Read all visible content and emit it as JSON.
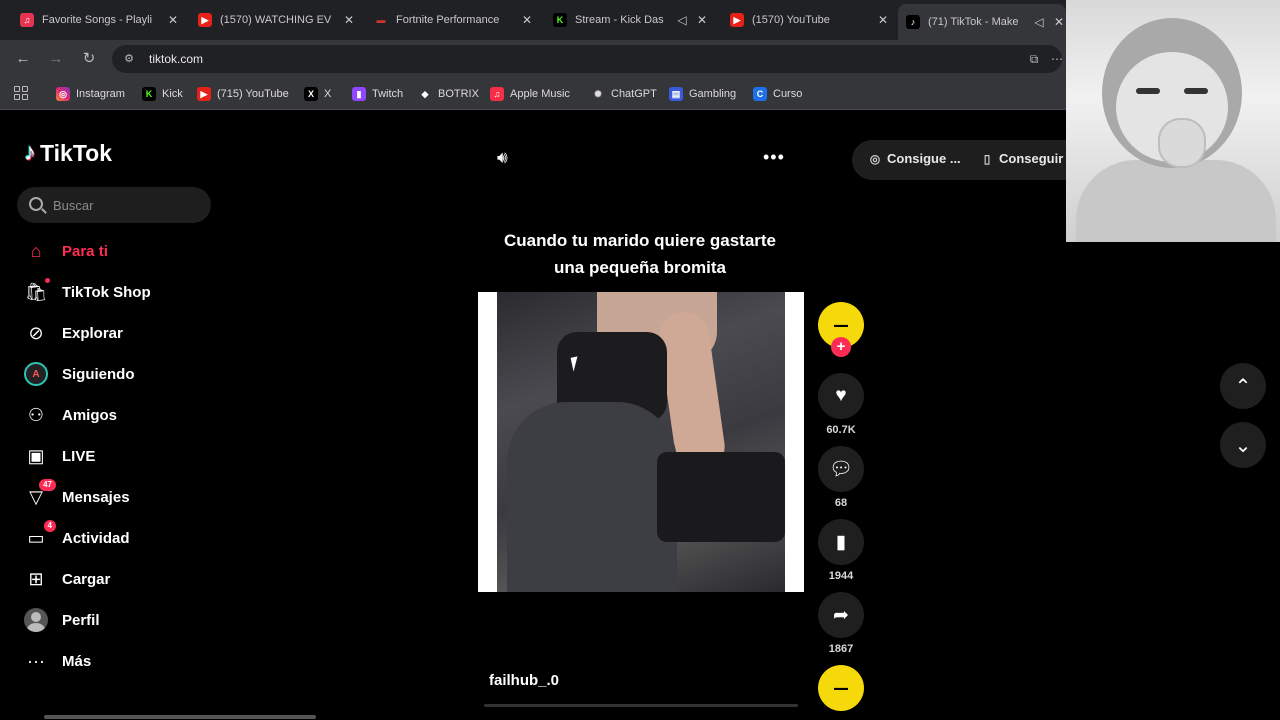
{
  "browser": {
    "tabs": [
      {
        "title": "Favorite Songs - Playli",
        "icon": "music-icon",
        "active": false
      },
      {
        "title": "(1570) WATCHING EV",
        "icon": "youtube-icon",
        "active": false
      },
      {
        "title": "Fortnite Performance",
        "icon": "page-icon",
        "active": false
      },
      {
        "title": "Stream - Kick Das",
        "icon": "kick-icon",
        "active": false
      },
      {
        "title": "(1570) YouTube",
        "icon": "youtube-icon",
        "active": false
      },
      {
        "title": "(71) TikTok - Make",
        "icon": "tiktok-icon",
        "active": true
      }
    ],
    "url": "tiktok.com",
    "bookmarks": [
      {
        "label": "Instagram",
        "icon": "instagram-icon"
      },
      {
        "label": "Kick",
        "icon": "kick-icon"
      },
      {
        "label": "(715) YouTube",
        "icon": "youtube-icon"
      },
      {
        "label": "X",
        "icon": "x-icon"
      },
      {
        "label": "Twitch",
        "icon": "twitch-icon"
      },
      {
        "label": "BOTRIX",
        "icon": "botrix-icon"
      },
      {
        "label": "Apple Music",
        "icon": "apple-music-icon"
      },
      {
        "label": "ChatGPT",
        "icon": "chatgpt-icon"
      },
      {
        "label": "Gambling",
        "icon": "gambling-icon"
      },
      {
        "label": "Curso",
        "icon": "curso-icon"
      }
    ]
  },
  "sidebar": {
    "logo": "TikTok",
    "search_placeholder": "Buscar",
    "items": [
      {
        "label": "Para ti",
        "icon": "home-icon",
        "active": true
      },
      {
        "label": "TikTok Shop",
        "icon": "shop-icon"
      },
      {
        "label": "Explorar",
        "icon": "compass-icon"
      },
      {
        "label": "Siguiendo",
        "icon": "following-avatar"
      },
      {
        "label": "Amigos",
        "icon": "friends-icon"
      },
      {
        "label": "LIVE",
        "icon": "live-icon"
      },
      {
        "label": "Mensajes",
        "icon": "messages-icon",
        "badge": "47"
      },
      {
        "label": "Actividad",
        "icon": "activity-icon",
        "badge": "4"
      },
      {
        "label": "Cargar",
        "icon": "upload-icon"
      },
      {
        "label": "Perfil",
        "icon": "profile-avatar"
      },
      {
        "label": "Más",
        "icon": "more-icon"
      }
    ]
  },
  "header": {
    "get_coins": "Consigue ...",
    "get_app": "Conseguir"
  },
  "post": {
    "caption_line1": "Cuando tu marido quiere gastarte",
    "caption_line2": "una pequeña bromita",
    "author": "failhub_.0",
    "likes": "60.7K",
    "comments": "68",
    "saves": "1944",
    "shares": "1867",
    "progress": 0.0
  },
  "colors": {
    "accent": "#fe2c55",
    "bg": "#000000",
    "avatar": "#f5d90a"
  }
}
